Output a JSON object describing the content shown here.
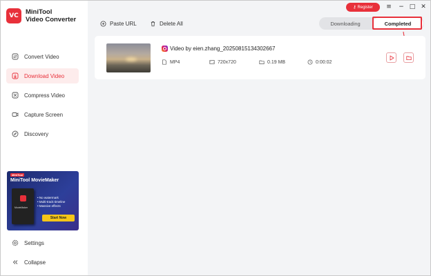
{
  "app": {
    "logo": "VC",
    "title_line1": "MiniTool",
    "title_line2": "Video Converter"
  },
  "sidebar": {
    "items": [
      {
        "label": "Convert Video",
        "icon": "convert-icon"
      },
      {
        "label": "Download Video",
        "icon": "download-icon",
        "active": true
      },
      {
        "label": "Compress Video",
        "icon": "compress-icon"
      },
      {
        "label": "Capture Screen",
        "icon": "camera-icon"
      },
      {
        "label": "Discovery",
        "icon": "compass-icon"
      }
    ],
    "settings_label": "Settings",
    "collapse_label": "Collapse"
  },
  "promo": {
    "tag": "MiniTool",
    "title": "MiniTool MovieMaker",
    "box_label": "MovieMaker",
    "features": [
      "No watermark",
      "Multi-track timeline",
      "Massive effects"
    ],
    "cta": "Start Now"
  },
  "header": {
    "register_label": "Register",
    "minimize": "−",
    "maximize": "□",
    "close": "✕"
  },
  "toolbar": {
    "paste_url_label": "Paste URL",
    "delete_all_label": "Delete All"
  },
  "tabs": {
    "downloading": "Downloading",
    "completed": "Completed"
  },
  "download_item": {
    "title": "Video by eien.zhang_20250815134302667",
    "format": "MP4",
    "resolution": "720x720",
    "size": "0.19 MB",
    "duration": "0:00:02"
  },
  "colors": {
    "accent": "#e8303a",
    "active_bg": "#fdecec",
    "main_bg": "#f3f4f6"
  }
}
